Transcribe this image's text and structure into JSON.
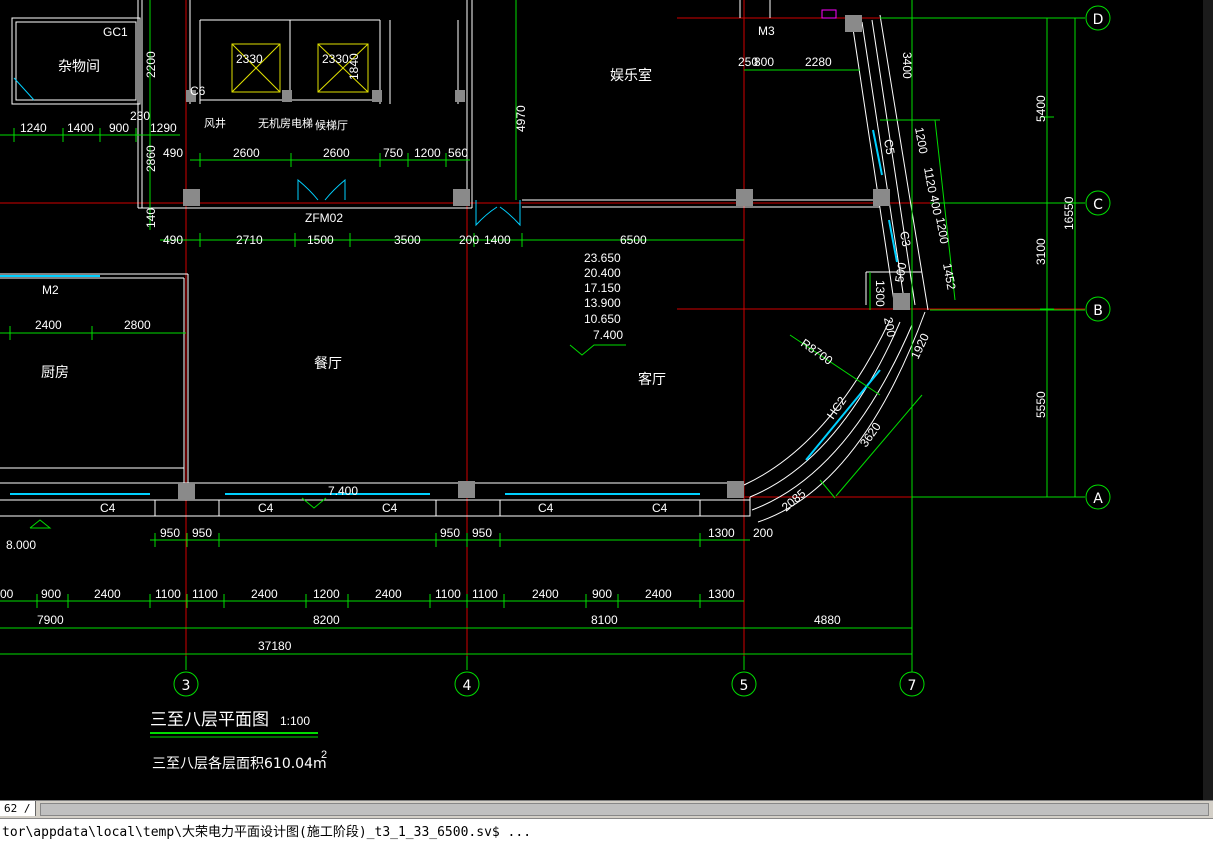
{
  "drawing": {
    "rooms": {
      "storage": "杂物间",
      "entertainment": "娱乐室",
      "kitchen": "厨房",
      "dining": "餐厅",
      "living": "客厅",
      "wind_shaft": "风井",
      "elevator": "无机房电梯",
      "stair_hall": "候梯厅"
    },
    "labels": {
      "gc1": "GC1",
      "m3": "M3",
      "m3v": "M3",
      "m2": "M2",
      "c6": "C6",
      "zfm02": "ZFM02",
      "elev1": "2330",
      "elev2": "2330",
      "elev2v": "1840",
      "hc2": "HC2",
      "c5": "C5",
      "c3": "C3",
      "r8700": "R8700",
      "c4a": "C4",
      "c4b": "C4",
      "c4c": "C4",
      "c4d": "C4",
      "c4e": "C4",
      "elev_mark": "7.400",
      "elev_left": "8.000"
    },
    "level_list": [
      "23.650",
      "20.400",
      "17.150",
      "13.900",
      "10.650",
      "7.400"
    ],
    "dims": {
      "d2200": "2200",
      "d230": "230",
      "d2860": "2860",
      "d140": "140",
      "d4970": "4970",
      "d250": "250",
      "d800": "800",
      "d2280": "2280",
      "d3400": "3400",
      "d5400": "5400",
      "d1200a": "1200",
      "d1120": "1120",
      "d400": "400",
      "d1200b": "1200",
      "d500": "500",
      "d1452": "1452",
      "d1300v": "1300",
      "d200v": "200",
      "d1920": "1920",
      "d3100": "3100",
      "d16550": "16550",
      "d5550": "5550",
      "d3620": "3620",
      "d2085": "2085",
      "d200b": "200"
    },
    "row1": [
      {
        "t": "1240"
      },
      {
        "t": "1400"
      },
      {
        "t": "900"
      },
      {
        "t": "1290"
      }
    ],
    "row2": [
      {
        "t": "490"
      },
      {
        "t": "2600"
      },
      {
        "t": "2600"
      },
      {
        "t": "750"
      },
      {
        "t": "1200"
      },
      {
        "t": "560"
      }
    ],
    "row3": [
      {
        "t": "490"
      },
      {
        "t": "2710"
      },
      {
        "t": "1500"
      },
      {
        "t": "3500"
      },
      {
        "t": "200"
      },
      {
        "t": "1400"
      },
      {
        "t": "6500"
      }
    ],
    "row_kitchen": [
      {
        "t": "2400"
      },
      {
        "t": "2800"
      }
    ],
    "row_win": [
      {
        "t": "950"
      },
      {
        "t": "950"
      },
      {
        "t": "950"
      },
      {
        "t": "950"
      },
      {
        "t": "1300"
      }
    ],
    "row_bottom1": [
      {
        "t": "00"
      },
      {
        "t": "900"
      },
      {
        "t": "2400"
      },
      {
        "t": "1100"
      },
      {
        "t": "1100"
      },
      {
        "t": "2400"
      },
      {
        "t": "1200"
      },
      {
        "t": "2400"
      },
      {
        "t": "1100"
      },
      {
        "t": "1100"
      },
      {
        "t": "2400"
      },
      {
        "t": "900"
      },
      {
        "t": "2400"
      },
      {
        "t": "1300"
      }
    ],
    "row_bottom2": [
      {
        "t": "7900"
      },
      {
        "t": "8200"
      },
      {
        "t": "8100"
      },
      {
        "t": "4880"
      }
    ],
    "total": "37180",
    "axes": {
      "a3": "3",
      "a4": "4",
      "a5": "5",
      "a7": "7",
      "aA": "A",
      "aB": "B",
      "aC": "C",
      "aD": "D"
    },
    "title": {
      "main": "三至八层平面图",
      "scale": "1:100",
      "area_prefix": "三至八层各层面积610.04m",
      "area_sup": "2"
    }
  },
  "tab": {
    "label": "62 /"
  },
  "command": {
    "text": "tor\\appdata\\local\\temp\\大荣电力平面设计图(施工阶段)_t3_1_33_6500.sv$ ..."
  },
  "colors": {
    "background": "#000000",
    "dimension": "#00ff00",
    "axis": "#ff0000",
    "wall": "#ffffff",
    "window": "#00ffff",
    "column": "#808080",
    "magenta": "#ff00ff",
    "yellow": "#ffff00"
  }
}
